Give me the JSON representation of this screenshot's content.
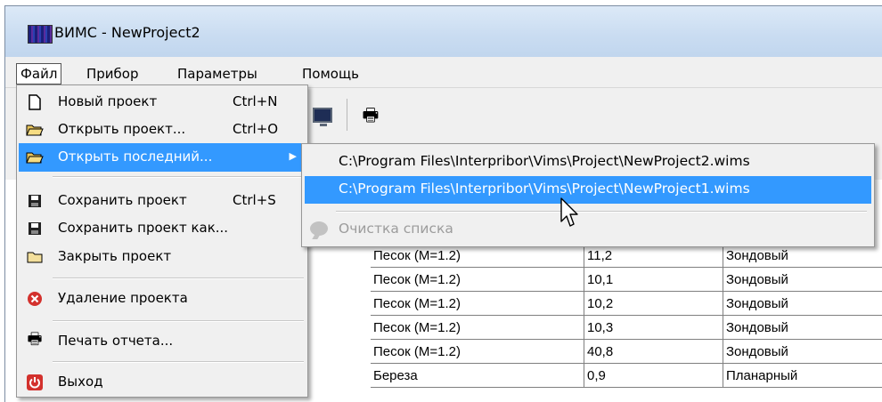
{
  "window": {
    "title": "ВИМС - NewProject2"
  },
  "menubar": [
    "Файл",
    "Прибор",
    "Параметры",
    "Помощь"
  ],
  "file_menu": {
    "items": [
      {
        "label": "Новый проект",
        "shortcut": "Ctrl+N",
        "icon": "new-file-icon"
      },
      {
        "label": "Открыть проект...",
        "shortcut": "Ctrl+O",
        "icon": "open-folder-icon"
      },
      {
        "label": "Открыть последний...",
        "shortcut": "",
        "icon": "open-folder-icon",
        "submenu_arrow": "▶"
      },
      {
        "label": "Сохранить проект",
        "shortcut": "Ctrl+S",
        "icon": "floppy-icon"
      },
      {
        "label": "Сохранить проект как...",
        "shortcut": "",
        "icon": "floppy-icon"
      },
      {
        "label": "Закрыть проект",
        "shortcut": "",
        "icon": "close-folder-icon"
      },
      {
        "label": "Удаление проекта",
        "shortcut": "",
        "icon": "delete-icon"
      },
      {
        "label": "Печать отчета...",
        "shortcut": "",
        "icon": "printer-icon"
      },
      {
        "label": "Выход",
        "shortcut": "",
        "icon": "power-icon"
      }
    ]
  },
  "recent_submenu": {
    "items": [
      "C:\\Program Files\\Interpribor\\Vims\\Project\\NewProject2.wims",
      "C:\\Program Files\\Interpribor\\Vims\\Project\\NewProject1.wims"
    ],
    "clear_label": "Очистка списка"
  },
  "grid": {
    "rows": [
      [
        "Песок (М=1.2)",
        "11,2",
        "Зондовый"
      ],
      [
        "Песок (М=1.2)",
        "10,1",
        "Зондовый"
      ],
      [
        "Песок (М=1.2)",
        "10,2",
        "Зондовый"
      ],
      [
        "Песок (М=1.2)",
        "10,3",
        "Зондовый"
      ],
      [
        "Песок (М=1.2)",
        "40,8",
        "Зондовый"
      ],
      [
        "Береза",
        "0,9",
        "Планарный"
      ]
    ]
  },
  "colors": {
    "highlight": "#3399ff",
    "menu_bg": "#f0f0f0"
  }
}
